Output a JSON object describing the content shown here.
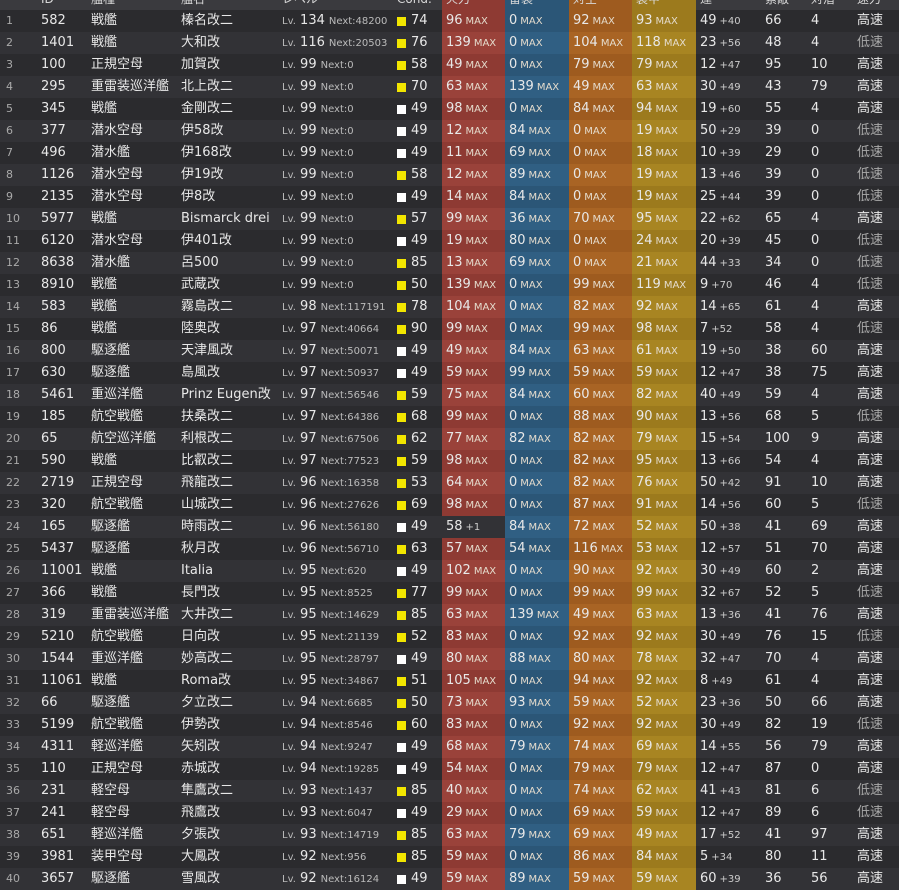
{
  "header": {
    "num": "",
    "id": "ID",
    "type": "艦種",
    "name": "艦名",
    "level": "レベル",
    "cond": "Cond.",
    "fire": "火力",
    "torpedo": "雷装",
    "aa": "対空",
    "armor": "装甲",
    "luck": "運",
    "slot": "索敵",
    "asw": "対潜",
    "speed": "速力"
  },
  "labels": {
    "lv": "Lv.",
    "next": "Next:",
    "max": "MAX"
  },
  "colors": {
    "cond_yellow": "#f2e600",
    "cond_white": "#ffffff",
    "firepower_max": "#8e3a33",
    "torpedo_max": "#2b5677",
    "antiair_max": "#9e5b1f",
    "armor_max": "#9c7a1d"
  },
  "ships": [
    {
      "n": "1",
      "id": "582",
      "type": "戦艦",
      "name": "榛名改二",
      "lv": "134",
      "next": "48200",
      "cond": "74",
      "cc": "yellow",
      "fire": "96",
      "fm": true,
      "tor": "0",
      "tm": true,
      "aa": "92",
      "am": true,
      "arm": "93",
      "rm": true,
      "luck": "49",
      "lp": "+40",
      "slot": "66",
      "asw": "4",
      "spd": "高速"
    },
    {
      "n": "2",
      "id": "1401",
      "type": "戦艦",
      "name": "大和改",
      "lv": "116",
      "next": "20503",
      "cond": "76",
      "cc": "yellow",
      "fire": "139",
      "fm": true,
      "tor": "0",
      "tm": true,
      "aa": "104",
      "am": true,
      "arm": "118",
      "rm": true,
      "luck": "23",
      "lp": "+56",
      "slot": "48",
      "asw": "4",
      "spd": "低速"
    },
    {
      "n": "3",
      "id": "100",
      "type": "正規空母",
      "name": "加賀改",
      "lv": "99",
      "next": "0",
      "cond": "58",
      "cc": "yellow",
      "fire": "49",
      "fm": true,
      "tor": "0",
      "tm": true,
      "aa": "79",
      "am": true,
      "arm": "79",
      "rm": true,
      "luck": "12",
      "lp": "+47",
      "slot": "95",
      "asw": "10",
      "spd": "高速"
    },
    {
      "n": "4",
      "id": "295",
      "type": "重雷装巡洋艦",
      "name": "北上改二",
      "lv": "99",
      "next": "0",
      "cond": "70",
      "cc": "yellow",
      "fire": "63",
      "fm": true,
      "tor": "139",
      "tm": true,
      "aa": "49",
      "am": true,
      "arm": "63",
      "rm": true,
      "luck": "30",
      "lp": "+49",
      "slot": "43",
      "asw": "79",
      "spd": "高速"
    },
    {
      "n": "5",
      "id": "345",
      "type": "戦艦",
      "name": "金剛改二",
      "lv": "99",
      "next": "0",
      "cond": "49",
      "cc": "white",
      "fire": "98",
      "fm": true,
      "tor": "0",
      "tm": true,
      "aa": "84",
      "am": true,
      "arm": "94",
      "rm": true,
      "luck": "19",
      "lp": "+60",
      "slot": "55",
      "asw": "4",
      "spd": "高速"
    },
    {
      "n": "6",
      "id": "377",
      "type": "潜水空母",
      "name": "伊58改",
      "lv": "99",
      "next": "0",
      "cond": "49",
      "cc": "white",
      "fire": "12",
      "fm": true,
      "tor": "84",
      "tm": true,
      "aa": "0",
      "am": true,
      "arm": "19",
      "rm": true,
      "luck": "50",
      "lp": "+29",
      "slot": "39",
      "asw": "0",
      "spd": "低速"
    },
    {
      "n": "7",
      "id": "496",
      "type": "潜水艦",
      "name": "伊168改",
      "lv": "99",
      "next": "0",
      "cond": "49",
      "cc": "white",
      "fire": "11",
      "fm": true,
      "tor": "69",
      "tm": true,
      "aa": "0",
      "am": true,
      "arm": "18",
      "rm": true,
      "luck": "10",
      "lp": "+39",
      "slot": "29",
      "asw": "0",
      "spd": "低速"
    },
    {
      "n": "8",
      "id": "1126",
      "type": "潜水空母",
      "name": "伊19改",
      "lv": "99",
      "next": "0",
      "cond": "58",
      "cc": "yellow",
      "fire": "12",
      "fm": true,
      "tor": "89",
      "tm": true,
      "aa": "0",
      "am": true,
      "arm": "19",
      "rm": true,
      "luck": "13",
      "lp": "+46",
      "slot": "39",
      "asw": "0",
      "spd": "低速"
    },
    {
      "n": "9",
      "id": "2135",
      "type": "潜水空母",
      "name": "伊8改",
      "lv": "99",
      "next": "0",
      "cond": "49",
      "cc": "white",
      "fire": "14",
      "fm": true,
      "tor": "84",
      "tm": true,
      "aa": "0",
      "am": true,
      "arm": "19",
      "rm": true,
      "luck": "25",
      "lp": "+44",
      "slot": "39",
      "asw": "0",
      "spd": "低速"
    },
    {
      "n": "10",
      "id": "5977",
      "type": "戦艦",
      "name": "Bismarck drei",
      "lv": "99",
      "next": "0",
      "cond": "57",
      "cc": "yellow",
      "fire": "99",
      "fm": true,
      "tor": "36",
      "tm": true,
      "aa": "70",
      "am": true,
      "arm": "95",
      "rm": true,
      "luck": "22",
      "lp": "+62",
      "slot": "65",
      "asw": "4",
      "spd": "高速"
    },
    {
      "n": "11",
      "id": "6120",
      "type": "潜水空母",
      "name": "伊401改",
      "lv": "99",
      "next": "0",
      "cond": "49",
      "cc": "white",
      "fire": "19",
      "fm": true,
      "tor": "80",
      "tm": true,
      "aa": "0",
      "am": true,
      "arm": "24",
      "rm": true,
      "luck": "20",
      "lp": "+39",
      "slot": "45",
      "asw": "0",
      "spd": "低速"
    },
    {
      "n": "12",
      "id": "8638",
      "type": "潜水艦",
      "name": "呂500",
      "lv": "99",
      "next": "0",
      "cond": "85",
      "cc": "yellow",
      "fire": "13",
      "fm": true,
      "tor": "69",
      "tm": true,
      "aa": "0",
      "am": true,
      "arm": "21",
      "rm": true,
      "luck": "44",
      "lp": "+33",
      "slot": "34",
      "asw": "0",
      "spd": "低速"
    },
    {
      "n": "13",
      "id": "8910",
      "type": "戦艦",
      "name": "武蔵改",
      "lv": "99",
      "next": "0",
      "cond": "50",
      "cc": "yellow",
      "fire": "139",
      "fm": true,
      "tor": "0",
      "tm": true,
      "aa": "99",
      "am": true,
      "arm": "119",
      "rm": true,
      "luck": "9",
      "lp": "+70",
      "slot": "46",
      "asw": "4",
      "spd": "低速"
    },
    {
      "n": "14",
      "id": "583",
      "type": "戦艦",
      "name": "霧島改二",
      "lv": "98",
      "next": "117191",
      "cond": "78",
      "cc": "yellow",
      "fire": "104",
      "fm": true,
      "tor": "0",
      "tm": true,
      "aa": "82",
      "am": true,
      "arm": "92",
      "rm": true,
      "luck": "14",
      "lp": "+65",
      "slot": "61",
      "asw": "4",
      "spd": "高速"
    },
    {
      "n": "15",
      "id": "86",
      "type": "戦艦",
      "name": "陸奥改",
      "lv": "97",
      "next": "40664",
      "cond": "90",
      "cc": "yellow",
      "fire": "99",
      "fm": true,
      "tor": "0",
      "tm": true,
      "aa": "99",
      "am": true,
      "arm": "98",
      "rm": true,
      "luck": "7",
      "lp": "+52",
      "slot": "58",
      "asw": "4",
      "spd": "低速"
    },
    {
      "n": "16",
      "id": "800",
      "type": "駆逐艦",
      "name": "天津風改",
      "lv": "97",
      "next": "50071",
      "cond": "49",
      "cc": "white",
      "fire": "49",
      "fm": true,
      "tor": "84",
      "tm": true,
      "aa": "63",
      "am": true,
      "arm": "61",
      "rm": true,
      "luck": "19",
      "lp": "+50",
      "slot": "38",
      "asw": "60",
      "spd": "高速"
    },
    {
      "n": "17",
      "id": "630",
      "type": "駆逐艦",
      "name": "島風改",
      "lv": "97",
      "next": "50937",
      "cond": "49",
      "cc": "white",
      "fire": "59",
      "fm": true,
      "tor": "99",
      "tm": true,
      "aa": "59",
      "am": true,
      "arm": "59",
      "rm": true,
      "luck": "12",
      "lp": "+47",
      "slot": "38",
      "asw": "75",
      "spd": "高速"
    },
    {
      "n": "18",
      "id": "5461",
      "type": "重巡洋艦",
      "name": "Prinz Eugen改",
      "lv": "97",
      "next": "56546",
      "cond": "59",
      "cc": "yellow",
      "fire": "75",
      "fm": true,
      "tor": "84",
      "tm": true,
      "aa": "60",
      "am": true,
      "arm": "82",
      "rm": true,
      "luck": "40",
      "lp": "+49",
      "slot": "59",
      "asw": "4",
      "spd": "高速"
    },
    {
      "n": "19",
      "id": "185",
      "type": "航空戦艦",
      "name": "扶桑改二",
      "lv": "97",
      "next": "64386",
      "cond": "68",
      "cc": "yellow",
      "fire": "99",
      "fm": true,
      "tor": "0",
      "tm": true,
      "aa": "88",
      "am": true,
      "arm": "90",
      "rm": true,
      "luck": "13",
      "lp": "+56",
      "slot": "68",
      "asw": "5",
      "spd": "低速"
    },
    {
      "n": "20",
      "id": "65",
      "type": "航空巡洋艦",
      "name": "利根改二",
      "lv": "97",
      "next": "67506",
      "cond": "62",
      "cc": "yellow",
      "fire": "77",
      "fm": true,
      "tor": "82",
      "tm": true,
      "aa": "82",
      "am": true,
      "arm": "79",
      "rm": true,
      "luck": "15",
      "lp": "+54",
      "slot": "100",
      "asw": "9",
      "spd": "高速"
    },
    {
      "n": "21",
      "id": "590",
      "type": "戦艦",
      "name": "比叡改二",
      "lv": "97",
      "next": "77523",
      "cond": "59",
      "cc": "yellow",
      "fire": "98",
      "fm": true,
      "tor": "0",
      "tm": true,
      "aa": "82",
      "am": true,
      "arm": "95",
      "rm": true,
      "luck": "13",
      "lp": "+66",
      "slot": "54",
      "asw": "4",
      "spd": "高速"
    },
    {
      "n": "22",
      "id": "2719",
      "type": "正規空母",
      "name": "飛龍改二",
      "lv": "96",
      "next": "16358",
      "cond": "53",
      "cc": "yellow",
      "fire": "64",
      "fm": true,
      "tor": "0",
      "tm": true,
      "aa": "82",
      "am": true,
      "arm": "76",
      "rm": true,
      "luck": "50",
      "lp": "+42",
      "slot": "91",
      "asw": "10",
      "spd": "高速"
    },
    {
      "n": "23",
      "id": "320",
      "type": "航空戦艦",
      "name": "山城改二",
      "lv": "96",
      "next": "27626",
      "cond": "69",
      "cc": "yellow",
      "fire": "98",
      "fm": true,
      "tor": "0",
      "tm": true,
      "aa": "87",
      "am": true,
      "arm": "91",
      "rm": true,
      "luck": "14",
      "lp": "+56",
      "slot": "60",
      "asw": "5",
      "spd": "低速"
    },
    {
      "n": "24",
      "id": "165",
      "type": "駆逐艦",
      "name": "時雨改二",
      "lv": "96",
      "next": "56180",
      "cond": "49",
      "cc": "white",
      "fire": "58",
      "fm": false,
      "fp": "+1",
      "tor": "84",
      "tm": true,
      "aa": "72",
      "am": true,
      "arm": "52",
      "rm": true,
      "luck": "50",
      "lp": "+38",
      "slot": "41",
      "asw": "69",
      "spd": "高速"
    },
    {
      "n": "25",
      "id": "5437",
      "type": "駆逐艦",
      "name": "秋月改",
      "lv": "96",
      "next": "56710",
      "cond": "63",
      "cc": "yellow",
      "fire": "57",
      "fm": true,
      "tor": "54",
      "tm": true,
      "aa": "116",
      "am": true,
      "arm": "53",
      "rm": true,
      "luck": "12",
      "lp": "+57",
      "slot": "51",
      "asw": "70",
      "spd": "高速"
    },
    {
      "n": "26",
      "id": "11001",
      "type": "戦艦",
      "name": "Italia",
      "lv": "95",
      "next": "620",
      "cond": "49",
      "cc": "white",
      "fire": "102",
      "fm": true,
      "tor": "0",
      "tm": true,
      "aa": "90",
      "am": true,
      "arm": "92",
      "rm": true,
      "luck": "30",
      "lp": "+49",
      "slot": "60",
      "asw": "2",
      "spd": "高速"
    },
    {
      "n": "27",
      "id": "366",
      "type": "戦艦",
      "name": "長門改",
      "lv": "95",
      "next": "8525",
      "cond": "77",
      "cc": "yellow",
      "fire": "99",
      "fm": true,
      "tor": "0",
      "tm": true,
      "aa": "99",
      "am": true,
      "arm": "99",
      "rm": true,
      "luck": "32",
      "lp": "+67",
      "slot": "52",
      "asw": "5",
      "spd": "低速"
    },
    {
      "n": "28",
      "id": "319",
      "type": "重雷装巡洋艦",
      "name": "大井改二",
      "lv": "95",
      "next": "14629",
      "cond": "85",
      "cc": "yellow",
      "fire": "63",
      "fm": true,
      "tor": "139",
      "tm": true,
      "aa": "49",
      "am": true,
      "arm": "63",
      "rm": true,
      "luck": "13",
      "lp": "+36",
      "slot": "41",
      "asw": "76",
      "spd": "高速"
    },
    {
      "n": "29",
      "id": "5210",
      "type": "航空戦艦",
      "name": "日向改",
      "lv": "95",
      "next": "21139",
      "cond": "52",
      "cc": "yellow",
      "fire": "83",
      "fm": true,
      "tor": "0",
      "tm": true,
      "aa": "92",
      "am": true,
      "arm": "92",
      "rm": true,
      "luck": "30",
      "lp": "+49",
      "slot": "76",
      "asw": "15",
      "spd": "低速"
    },
    {
      "n": "30",
      "id": "1544",
      "type": "重巡洋艦",
      "name": "妙高改二",
      "lv": "95",
      "next": "28797",
      "cond": "49",
      "cc": "white",
      "fire": "80",
      "fm": true,
      "tor": "88",
      "tm": true,
      "aa": "80",
      "am": true,
      "arm": "78",
      "rm": true,
      "luck": "32",
      "lp": "+47",
      "slot": "70",
      "asw": "4",
      "spd": "高速"
    },
    {
      "n": "31",
      "id": "11061",
      "type": "戦艦",
      "name": "Roma改",
      "lv": "95",
      "next": "34867",
      "cond": "51",
      "cc": "yellow",
      "fire": "105",
      "fm": true,
      "tor": "0",
      "tm": true,
      "aa": "94",
      "am": true,
      "arm": "92",
      "rm": true,
      "luck": "8",
      "lp": "+49",
      "slot": "61",
      "asw": "4",
      "spd": "高速"
    },
    {
      "n": "32",
      "id": "66",
      "type": "駆逐艦",
      "name": "夕立改二",
      "lv": "94",
      "next": "6685",
      "cond": "50",
      "cc": "yellow",
      "fire": "73",
      "fm": true,
      "tor": "93",
      "tm": true,
      "aa": "59",
      "am": true,
      "arm": "52",
      "rm": true,
      "luck": "23",
      "lp": "+36",
      "slot": "50",
      "asw": "66",
      "spd": "高速"
    },
    {
      "n": "33",
      "id": "5199",
      "type": "航空戦艦",
      "name": "伊勢改",
      "lv": "94",
      "next": "8546",
      "cond": "60",
      "cc": "yellow",
      "fire": "83",
      "fm": true,
      "tor": "0",
      "tm": true,
      "aa": "92",
      "am": true,
      "arm": "92",
      "rm": true,
      "luck": "30",
      "lp": "+49",
      "slot": "82",
      "asw": "19",
      "spd": "低速"
    },
    {
      "n": "34",
      "id": "4311",
      "type": "軽巡洋艦",
      "name": "矢矧改",
      "lv": "94",
      "next": "9247",
      "cond": "49",
      "cc": "white",
      "fire": "68",
      "fm": true,
      "tor": "79",
      "tm": true,
      "aa": "74",
      "am": true,
      "arm": "69",
      "rm": true,
      "luck": "14",
      "lp": "+55",
      "slot": "56",
      "asw": "79",
      "spd": "高速"
    },
    {
      "n": "35",
      "id": "110",
      "type": "正規空母",
      "name": "赤城改",
      "lv": "94",
      "next": "19285",
      "cond": "49",
      "cc": "white",
      "fire": "54",
      "fm": true,
      "tor": "0",
      "tm": true,
      "aa": "79",
      "am": true,
      "arm": "79",
      "rm": true,
      "luck": "12",
      "lp": "+47",
      "slot": "87",
      "asw": "0",
      "spd": "高速"
    },
    {
      "n": "36",
      "id": "231",
      "type": "軽空母",
      "name": "隼鷹改二",
      "lv": "93",
      "next": "1437",
      "cond": "85",
      "cc": "yellow",
      "fire": "40",
      "fm": true,
      "tor": "0",
      "tm": true,
      "aa": "74",
      "am": true,
      "arm": "62",
      "rm": true,
      "luck": "41",
      "lp": "+43",
      "slot": "81",
      "asw": "6",
      "spd": "低速"
    },
    {
      "n": "37",
      "id": "241",
      "type": "軽空母",
      "name": "飛鷹改",
      "lv": "93",
      "next": "6047",
      "cond": "49",
      "cc": "white",
      "fire": "29",
      "fm": true,
      "tor": "0",
      "tm": true,
      "aa": "69",
      "am": true,
      "arm": "59",
      "rm": true,
      "luck": "12",
      "lp": "+47",
      "slot": "89",
      "asw": "6",
      "spd": "低速"
    },
    {
      "n": "38",
      "id": "651",
      "type": "軽巡洋艦",
      "name": "夕張改",
      "lv": "93",
      "next": "14719",
      "cond": "85",
      "cc": "yellow",
      "fire": "63",
      "fm": true,
      "tor": "79",
      "tm": true,
      "aa": "69",
      "am": true,
      "arm": "49",
      "rm": true,
      "luck": "17",
      "lp": "+52",
      "slot": "41",
      "asw": "97",
      "spd": "高速"
    },
    {
      "n": "39",
      "id": "3981",
      "type": "装甲空母",
      "name": "大鳳改",
      "lv": "92",
      "next": "956",
      "cond": "85",
      "cc": "yellow",
      "fire": "59",
      "fm": true,
      "tor": "0",
      "tm": true,
      "aa": "86",
      "am": true,
      "arm": "84",
      "rm": true,
      "luck": "5",
      "lp": "+34",
      "slot": "80",
      "asw": "11",
      "spd": "高速"
    },
    {
      "n": "40",
      "id": "3657",
      "type": "駆逐艦",
      "name": "雪風改",
      "lv": "92",
      "next": "16124",
      "cond": "49",
      "cc": "white",
      "fire": "59",
      "fm": true,
      "tor": "89",
      "tm": true,
      "aa": "59",
      "am": true,
      "arm": "59",
      "rm": true,
      "luck": "60",
      "lp": "+39",
      "slot": "36",
      "asw": "56",
      "spd": "高速"
    }
  ]
}
